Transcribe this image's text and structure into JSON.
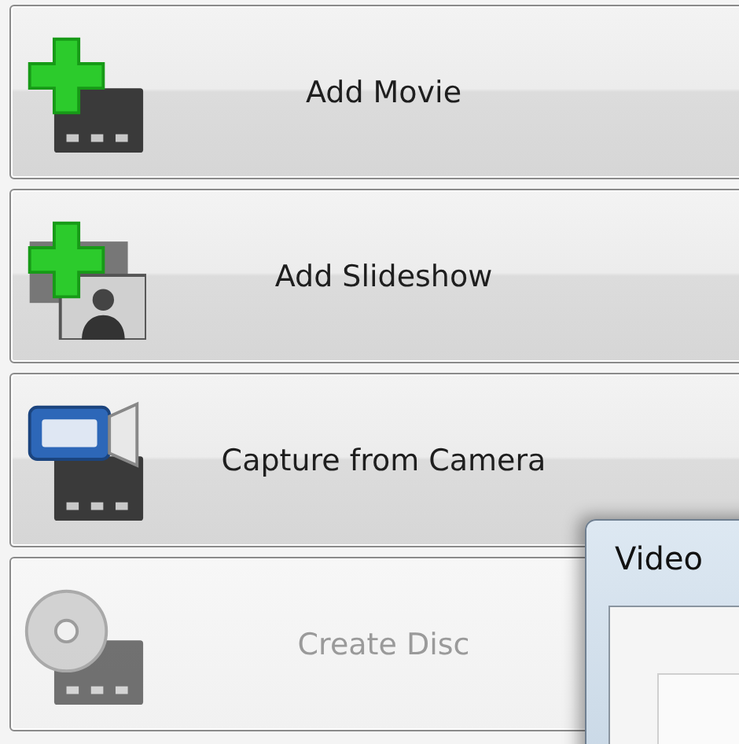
{
  "buttons": [
    {
      "kind": "add-movie",
      "label": "Add Movie",
      "disabled": false
    },
    {
      "kind": "add-slideshow",
      "label": "Add Slideshow",
      "disabled": false
    },
    {
      "kind": "camera",
      "label": "Capture from Camera",
      "disabled": false
    },
    {
      "kind": "disc",
      "label": "Create Disc",
      "disabled": true
    }
  ],
  "dialog": {
    "title": "Video"
  }
}
